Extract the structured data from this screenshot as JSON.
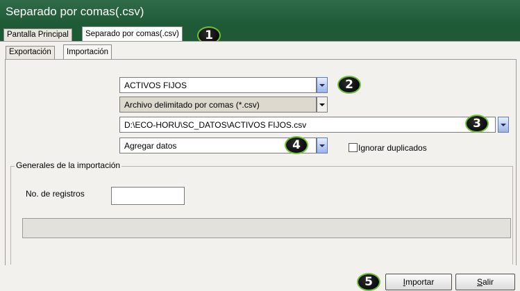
{
  "window": {
    "title": "Separado por comas(.csv)"
  },
  "main_tabs": [
    {
      "label": "Pantalla Principal",
      "active": false
    },
    {
      "label": "Separado por comas(.csv)",
      "active": true
    }
  ],
  "sub_tabs": [
    {
      "label": "Exportación",
      "active": false
    },
    {
      "label": "Importación",
      "active": true
    }
  ],
  "form": {
    "table_select": {
      "value": "ACTIVOS FIJOS"
    },
    "file_type_select": {
      "value": "Archivo delimitado por comas (*.csv)"
    },
    "file_path_select": {
      "value": "D:\\ECO-HORU\\SC_DATOS\\ACTIVOS FIJOS.csv"
    },
    "mode_select": {
      "value": "Agregar datos"
    },
    "ignore_duplicates": {
      "label": "Ignorar duplicados",
      "checked": false
    }
  },
  "import_group": {
    "title": "Generales de la importación",
    "records_label": "No. de registros",
    "records_value": "",
    "progress": 0
  },
  "buttons": {
    "import": {
      "accel": "I",
      "rest": "mportar"
    },
    "exit": {
      "accel": "S",
      "rest": "alir"
    }
  },
  "badges": [
    "1",
    "2",
    "3",
    "4",
    "5"
  ],
  "colors": {
    "titlebar": "#1f5a37",
    "dropdown_accent": "#5a7bb8",
    "badge_ring": "#6fbf3a"
  }
}
